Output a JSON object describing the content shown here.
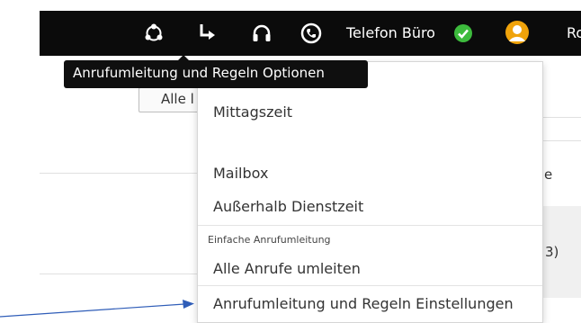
{
  "topbar": {
    "telefon_label": "Telefon Büro",
    "user_partial": "Ro",
    "icons": [
      "network-icon",
      "call-forward-icon",
      "headset-icon",
      "phone-icon",
      "check-circle-icon",
      "user-avatar-icon"
    ]
  },
  "tooltip": {
    "text": "Anrufumleitung und Regeln Optionen"
  },
  "background": {
    "button_partial": "Alle l",
    "row_partial_e": "e",
    "row_partial_count": "3)"
  },
  "menu": {
    "items": [
      {
        "label": "Mittagszeit"
      },
      {
        "label": "Mailbox"
      },
      {
        "label": "Außerhalb Dienstzeit"
      },
      {
        "label": "Alle Anrufe umleiten"
      },
      {
        "label": "Anrufumleitung und Regeln Einstellungen"
      }
    ],
    "section_header": "Einfache Anrufumleitung"
  },
  "colors": {
    "topbar_bg": "#0b0b0b",
    "status_green": "#3dbb3d",
    "annotation_blue": "#2f5db8"
  }
}
